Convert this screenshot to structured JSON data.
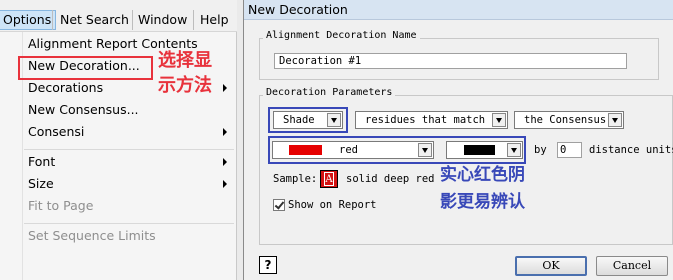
{
  "menubar": {
    "items": [
      {
        "label": "Options"
      },
      {
        "label": "Net Search"
      },
      {
        "label": "Window"
      },
      {
        "label": "Help"
      }
    ]
  },
  "options_menu": {
    "items": [
      {
        "label": "Alignment Report Contents"
      },
      {
        "label": "New Decoration..."
      },
      {
        "label": "Decorations"
      },
      {
        "label": "New Consensus..."
      },
      {
        "label": "Consensi"
      },
      {
        "label": "Font"
      },
      {
        "label": "Size"
      },
      {
        "label": "Fit to Page"
      },
      {
        "label": "Set Sequence Limits"
      }
    ]
  },
  "annotations": {
    "left_line1": "选择显",
    "left_line2": "示方法",
    "right_line1": "实心红色阴",
    "right_line2": "影更易辨认"
  },
  "dialog": {
    "title": "New Decoration",
    "name_group": {
      "legend": "Alignment Decoration Name",
      "value": "Decoration #1"
    },
    "params_group": {
      "legend": "Decoration Parameters",
      "style_select": "Shade",
      "match_select": "residues that match",
      "target_select": "the Consensus",
      "color_select": "red",
      "color_hex": "#e60000",
      "outline_hex": "#000000",
      "by_label": "by",
      "distance_value": "0",
      "distance_units": "distance units",
      "sample_label": "Sample:",
      "sample_glyph": "A",
      "sample_desc": "solid deep red",
      "show_on_report_label": "Show on Report",
      "show_on_report_checked": true
    },
    "buttons": {
      "help": "?",
      "ok": "OK",
      "cancel": "Cancel"
    }
  }
}
